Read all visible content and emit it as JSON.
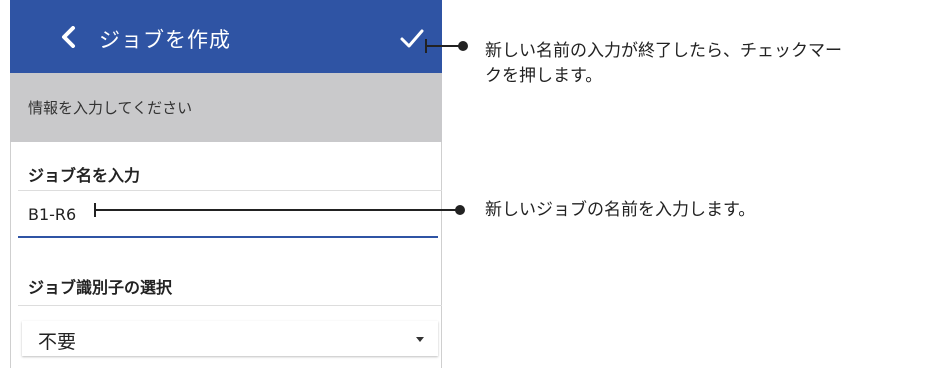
{
  "appbar": {
    "title": "ジョブを作成",
    "back_icon": "chevron-left-icon",
    "confirm_icon": "check-icon",
    "color": "#2f54a4"
  },
  "info_banner": {
    "text": "情報を入力してください"
  },
  "job_name": {
    "label": "ジョブ名を入力",
    "value": "B1-R6"
  },
  "job_id": {
    "label": "ジョブ識別子の選択",
    "selected": "不要"
  },
  "callouts": {
    "confirm_line1": "新しい名前の入力が終了したら、チェックマー",
    "confirm_line2": "クを押します。",
    "name": "新しいジョブの名前を入力します。"
  }
}
